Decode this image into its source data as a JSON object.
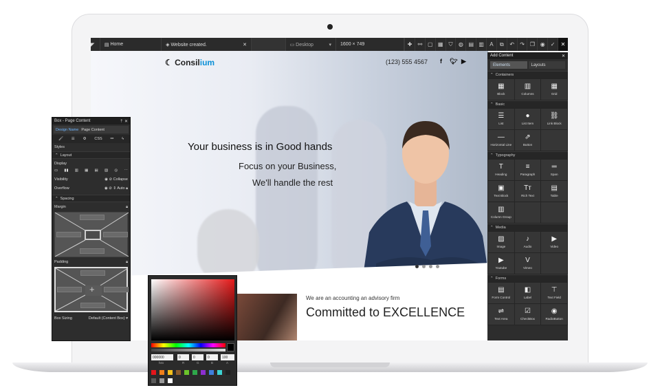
{
  "toolbar": {
    "home": "Home",
    "message": "Website created.",
    "device": "Desktop",
    "resolution": "1600 × 749"
  },
  "site": {
    "logo": "Consilium",
    "logo_prefix": "Consil",
    "logo_accent": "ium",
    "phone": "(123) 555 4567",
    "headline": "Your business is in Good hands",
    "sub1": "Focus on your Business,",
    "sub2": "We'll handle the rest",
    "tagline": "We are an accounting an advisory firm",
    "commit": "Committed to EXCELLENCE"
  },
  "add_panel": {
    "title": "Add Content",
    "tab_elements": "Elements",
    "tab_layouts": "Layouts",
    "sections": [
      {
        "name": "Containers",
        "items": [
          {
            "label": "Block",
            "icon": "▦"
          },
          {
            "label": "Columns",
            "icon": "▥"
          },
          {
            "label": "Grid",
            "icon": "▦"
          }
        ]
      },
      {
        "name": "Basic",
        "items": [
          {
            "label": "List",
            "icon": "☰"
          },
          {
            "label": "List Item",
            "icon": "●"
          },
          {
            "label": "Link Block",
            "icon": "⛓"
          },
          {
            "label": "Horizontal Line",
            "icon": "—"
          },
          {
            "label": "Button",
            "icon": "⇗"
          }
        ]
      },
      {
        "name": "Typography",
        "items": [
          {
            "label": "Heading",
            "icon": "T"
          },
          {
            "label": "Paragraph",
            "icon": "≡"
          },
          {
            "label": "Span",
            "icon": "═"
          },
          {
            "label": "Text Block",
            "icon": "▣"
          },
          {
            "label": "Rich Text",
            "icon": "Tт"
          },
          {
            "label": "Table",
            "icon": "▤"
          },
          {
            "label": "Column Group",
            "icon": "▥"
          }
        ]
      },
      {
        "name": "Media",
        "items": [
          {
            "label": "Image",
            "icon": "▨"
          },
          {
            "label": "Audio",
            "icon": "♪"
          },
          {
            "label": "Video",
            "icon": "▶"
          },
          {
            "label": "Youtube",
            "icon": "▶"
          },
          {
            "label": "Vimeo",
            "icon": "V"
          }
        ]
      },
      {
        "name": "Forms",
        "items": [
          {
            "label": "Form Control",
            "icon": "▤"
          },
          {
            "label": "Label",
            "icon": "◧"
          },
          {
            "label": "Text Field",
            "icon": "⊤"
          },
          {
            "label": "Text Area",
            "icon": "⇌"
          },
          {
            "label": "CheckBox",
            "icon": "☑"
          },
          {
            "label": "RadioButton",
            "icon": "◉"
          }
        ]
      }
    ]
  },
  "style_panel": {
    "title": "Box - Page Content",
    "design_name_label": "Design Name",
    "design_name_value": "Page Content",
    "css_tab": "CSS",
    "styles_heading": "Styles",
    "layout_section": "Layout",
    "display_label": "Display",
    "visibility_label": "Visibility",
    "visibility_value": "Collapse",
    "overflow_label": "Overflow",
    "overflow_value": "Auto",
    "spacing_section": "Spacing",
    "margin_label": "Margin",
    "padding_label": "Padding",
    "box_sizing_label": "Box Sizing",
    "box_sizing_value": "Default (Content Box)"
  },
  "color_picker": {
    "hex": "000000",
    "r": "0",
    "g": "0",
    "b": "0",
    "a": "100",
    "hex_label": "hex",
    "r_label": "R",
    "g_label": "G",
    "b_label": "B",
    "a_label": "A",
    "swatches": [
      "#e3151b",
      "#f07f1a",
      "#f6c11b",
      "#8a5a2b",
      "#6cc52b",
      "#2ea84a",
      "#8d2fd0",
      "#3f7fdd",
      "#3cd2d2",
      "#1f1f1f",
      "#5a5a5a",
      "#9a9a9a",
      "#ffffff"
    ]
  }
}
